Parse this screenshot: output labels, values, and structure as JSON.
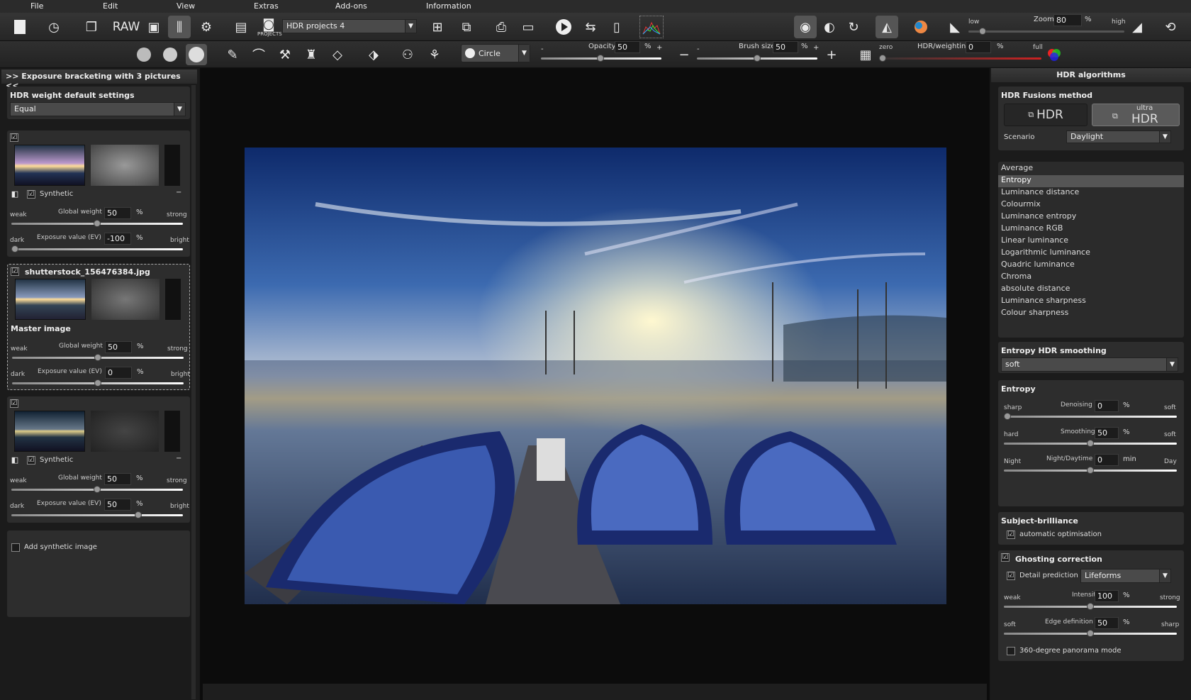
{
  "menu": {
    "file": "File",
    "edit": "Edit",
    "view": "View",
    "extras": "Extras",
    "addons": "Add-ons",
    "information": "Information"
  },
  "toolbar": {
    "raw": "RAW",
    "projects_label": "PROJECTS",
    "project_select": "HDR projects 4",
    "zoom_label": "Zoom",
    "zoom_value": "80",
    "zoom_unit": "%",
    "zoom_low": "low",
    "zoom_high": "high"
  },
  "toolbar2": {
    "shape_select": "Circle",
    "opacity_label": "Opacity",
    "opacity_value": "50",
    "opacity_unit": "%",
    "brush_label": "Brush size",
    "brush_value": "50",
    "brush_unit": "%",
    "minus": "-",
    "plus": "+",
    "minus_btn": "−",
    "plus_btn": "+",
    "hdr_zero": "zero",
    "hdr_label": "HDR/weighting",
    "hdr_value": "0",
    "hdr_unit": "%",
    "hdr_full": "full"
  },
  "left": {
    "title": ">> Exposure bracketing with 3 pictures <<",
    "default_label": "HDR weight default settings",
    "default_value": "Equal",
    "img1": {
      "synthetic": "Synthetic",
      "weak": "weak",
      "gw_label": "Global weight",
      "gw_value": "50",
      "pct": "%",
      "strong": "strong",
      "dark": "dark",
      "ev_label": "Exposure value (EV)",
      "ev_value": "-100",
      "bright": "bright",
      "gw_level": 0.5,
      "ev_level": 0.0
    },
    "img2": {
      "filename": "shutterstock_156476384.jpg",
      "master": "Master image",
      "weak": "weak",
      "gw_label": "Global weight",
      "gw_value": "50",
      "pct": "%",
      "strong": "strong",
      "dark": "dark",
      "ev_label": "Exposure value (EV)",
      "ev_value": "0",
      "bright": "bright",
      "gw_level": 0.5,
      "ev_level": 0.5
    },
    "img3": {
      "synthetic": "Synthetic",
      "weak": "weak",
      "gw_label": "Global weight",
      "gw_value": "50",
      "pct": "%",
      "strong": "strong",
      "dark": "dark",
      "ev_label": "Exposure value (EV)",
      "ev_value": "50",
      "bright": "bright",
      "gw_level": 0.5,
      "ev_level": 0.75
    },
    "add_synthetic": "Add synthetic image"
  },
  "right": {
    "title": "HDR algorithms",
    "fusion_label": "HDR Fusions method",
    "hdr_btn": "HDR",
    "ultra_small": "ultra",
    "ultra_btn": "HDR",
    "scenario_label": "Scenario",
    "scenario_value": "Daylight",
    "algorithms": [
      "Average",
      "Entropy",
      "Luminance distance",
      "Colourmix",
      "Luminance entropy",
      "Luminance RGB",
      "Linear luminance",
      "Logarithmic luminance",
      "Quadric luminance",
      "Chroma",
      "absolute distance",
      "Luminance sharpness",
      "Colour sharpness"
    ],
    "selected_algorithm": "Entropy",
    "smoothing_label": "Entropy HDR smoothing",
    "smoothing_value": "soft",
    "entropy_label": "Entropy",
    "denoise": {
      "left": "sharp",
      "label": "Denoising",
      "value": "0",
      "unit": "%",
      "right": "soft",
      "level": 0.0
    },
    "smooth": {
      "left": "hard",
      "label": "Smoothing",
      "value": "50",
      "unit": "%",
      "right": "soft",
      "level": 0.5
    },
    "night": {
      "left": "Night",
      "label": "Night/Daytime",
      "value": "0",
      "unit": "min",
      "right": "Day",
      "level": 0.5
    },
    "brilliance_label": "Subject-brilliance",
    "auto_opt": "automatic optimisation",
    "ghost_label": "Ghosting correction",
    "detail_label": "Detail prediction",
    "detail_value": "Lifeforms",
    "intensity": {
      "left": "weak",
      "label": "Intensity",
      "value": "100",
      "unit": "%",
      "right": "strong",
      "level": 0.5
    },
    "edge": {
      "left": "soft",
      "label": "Edge definition",
      "value": "50",
      "unit": "%",
      "right": "sharp",
      "level": 0.5
    },
    "panorama": "360-degree panorama mode"
  }
}
